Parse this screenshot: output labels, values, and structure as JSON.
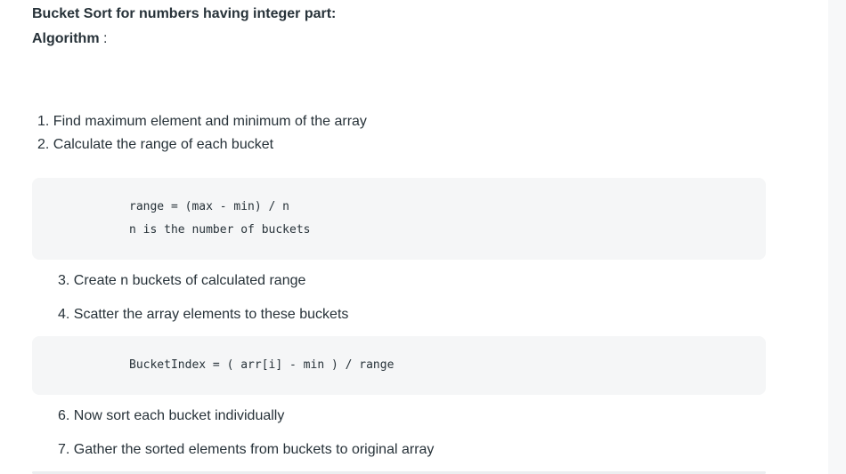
{
  "title": "Bucket Sort for numbers having integer part:",
  "algorithm_label": "Algorithm",
  "algorithm_sep": " :",
  "steps": [
    "1. Find maximum element and minimum of the array",
    "2. Calculate the range of each bucket",
    "3. Create n buckets of calculated range",
    "4. Scatter the array elements to these buckets",
    "6. Now sort each bucket individually",
    "7. Gather the sorted elements from buckets to original array"
  ],
  "code_blocks": [
    {
      "lines": [
        "range = (max - min) / n",
        "n is the number of buckets"
      ]
    },
    {
      "lines": [
        "BucketIndex = ( arr[i] - min ) / range"
      ]
    }
  ]
}
